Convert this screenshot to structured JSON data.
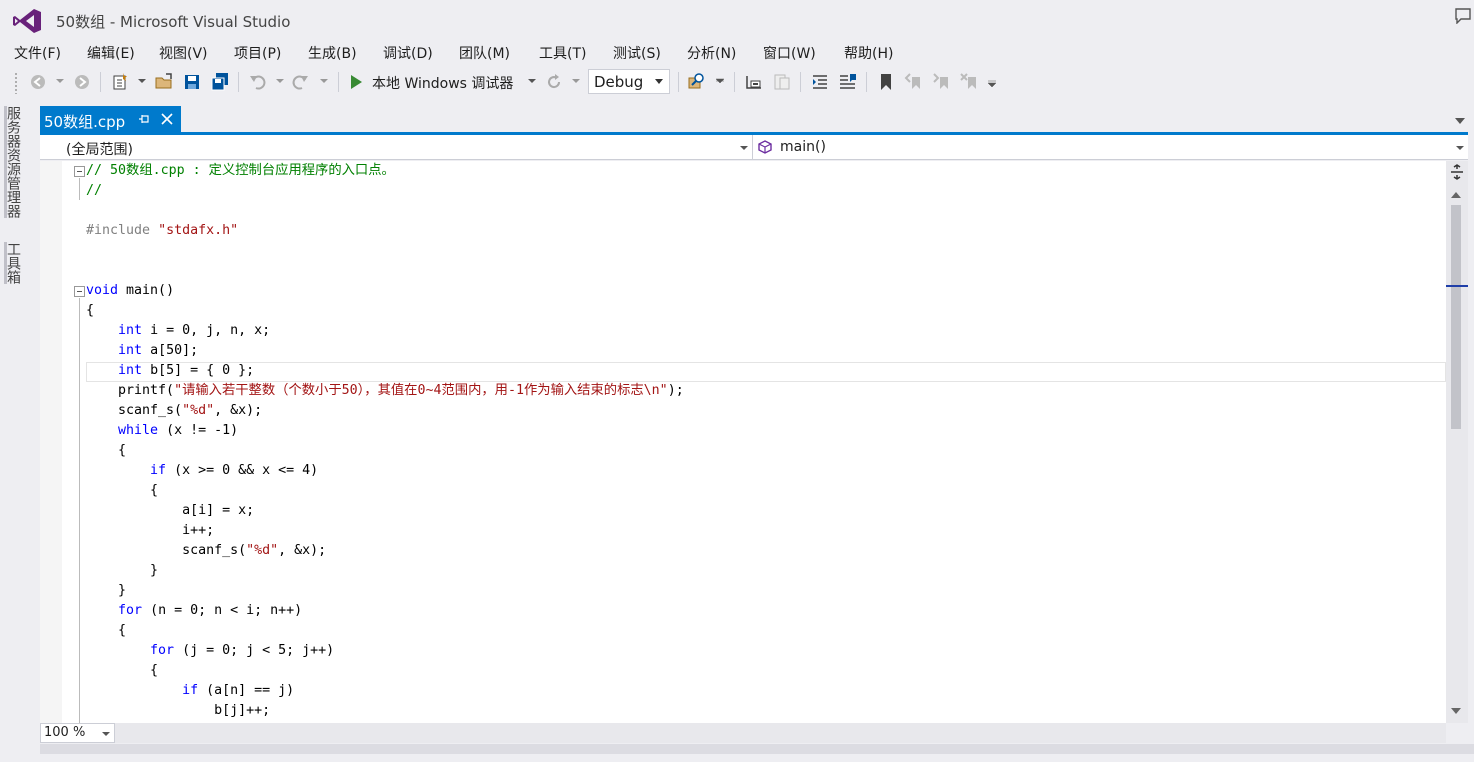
{
  "window": {
    "title": "50数组 - Microsoft Visual Studio"
  },
  "menu": [
    "文件(F)",
    "编辑(E)",
    "视图(V)",
    "项目(P)",
    "生成(B)",
    "调试(D)",
    "团队(M)",
    "工具(T)",
    "测试(S)",
    "分析(N)",
    "窗口(W)",
    "帮助(H)"
  ],
  "toolbar": {
    "debugger_label": "本地 Windows 调试器",
    "configuration": "Debug"
  },
  "side_tabs": [
    "服务器资源管理器",
    "工具箱"
  ],
  "document_tab": {
    "name": "50数组.cpp"
  },
  "navbar": {
    "scope": "(全局范围)",
    "member": "main()"
  },
  "zoom": "100 %",
  "colors": {
    "accent": "#007acc",
    "keyword": "#0000ff",
    "comment": "#008000",
    "string": "#a31515",
    "preprocessor": "#808080"
  },
  "code_lines": [
    [
      {
        "t": "// 50数组.cpp : 定义控制台应用程序的入口点。",
        "c": "com"
      }
    ],
    [
      {
        "t": "//",
        "c": "com"
      }
    ],
    [],
    [
      {
        "t": "#include ",
        "c": "pp"
      },
      {
        "t": "\"stdafx.h\"",
        "c": "str"
      }
    ],
    [],
    [],
    [
      {
        "t": "void",
        "c": "kw"
      },
      {
        "t": " main()",
        "c": ""
      }
    ],
    [
      {
        "t": "{",
        "c": ""
      }
    ],
    [
      {
        "t": "    ",
        "c": ""
      },
      {
        "t": "int",
        "c": "kw"
      },
      {
        "t": " i = 0, j, n, x;",
        "c": ""
      }
    ],
    [
      {
        "t": "    ",
        "c": ""
      },
      {
        "t": "int",
        "c": "kw"
      },
      {
        "t": " a[50];",
        "c": ""
      }
    ],
    [
      {
        "t": "    ",
        "c": ""
      },
      {
        "t": "int",
        "c": "kw"
      },
      {
        "t": " b[5] = { 0 };",
        "c": ""
      }
    ],
    [
      {
        "t": "    printf(",
        "c": ""
      },
      {
        "t": "\"请输入若干整数（个数小于50），其值在0~4范围内，用-1作为输入结束的标志\\n\"",
        "c": "str"
      },
      {
        "t": ");",
        "c": ""
      }
    ],
    [
      {
        "t": "    scanf_s(",
        "c": ""
      },
      {
        "t": "\"%d\"",
        "c": "str"
      },
      {
        "t": ", &x);",
        "c": ""
      }
    ],
    [
      {
        "t": "    ",
        "c": ""
      },
      {
        "t": "while",
        "c": "kw"
      },
      {
        "t": " (x != -1)",
        "c": ""
      }
    ],
    [
      {
        "t": "    {",
        "c": ""
      }
    ],
    [
      {
        "t": "        ",
        "c": ""
      },
      {
        "t": "if",
        "c": "kw"
      },
      {
        "t": " (x >= 0 && x <= 4)",
        "c": ""
      }
    ],
    [
      {
        "t": "        {",
        "c": ""
      }
    ],
    [
      {
        "t": "            a[i] = x;",
        "c": ""
      }
    ],
    [
      {
        "t": "            i++;",
        "c": ""
      }
    ],
    [
      {
        "t": "            scanf_s(",
        "c": ""
      },
      {
        "t": "\"%d\"",
        "c": "str"
      },
      {
        "t": ", &x);",
        "c": ""
      }
    ],
    [
      {
        "t": "        }",
        "c": ""
      }
    ],
    [
      {
        "t": "    }",
        "c": ""
      }
    ],
    [
      {
        "t": "    ",
        "c": ""
      },
      {
        "t": "for",
        "c": "kw"
      },
      {
        "t": " (n = 0; n < i; n++)",
        "c": ""
      }
    ],
    [
      {
        "t": "    {",
        "c": ""
      }
    ],
    [
      {
        "t": "        ",
        "c": ""
      },
      {
        "t": "for",
        "c": "kw"
      },
      {
        "t": " (j = 0; j < 5; j++)",
        "c": ""
      }
    ],
    [
      {
        "t": "        {",
        "c": ""
      }
    ],
    [
      {
        "t": "            ",
        "c": ""
      },
      {
        "t": "if",
        "c": "kw"
      },
      {
        "t": " (a[n] == j)",
        "c": ""
      }
    ],
    [
      {
        "t": "                b[j]++;",
        "c": ""
      }
    ]
  ]
}
